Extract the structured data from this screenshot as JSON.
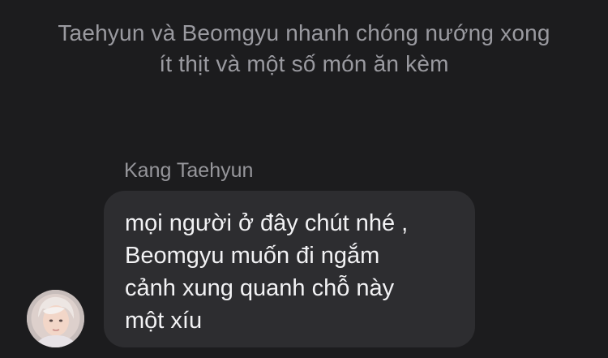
{
  "narration": {
    "text": "Taehyun và Beomgyu nhanh chóng nướng xong ít thịt và một số món ăn kèm"
  },
  "message": {
    "sender": "Kang Taehyun",
    "lines": [
      "mọi người ở đây chút nhé ,",
      "Beomgyu muốn đi ngắm",
      "cảnh xung quanh chỗ này",
      "một xíu"
    ],
    "avatar_icon": "profile-avatar"
  }
}
